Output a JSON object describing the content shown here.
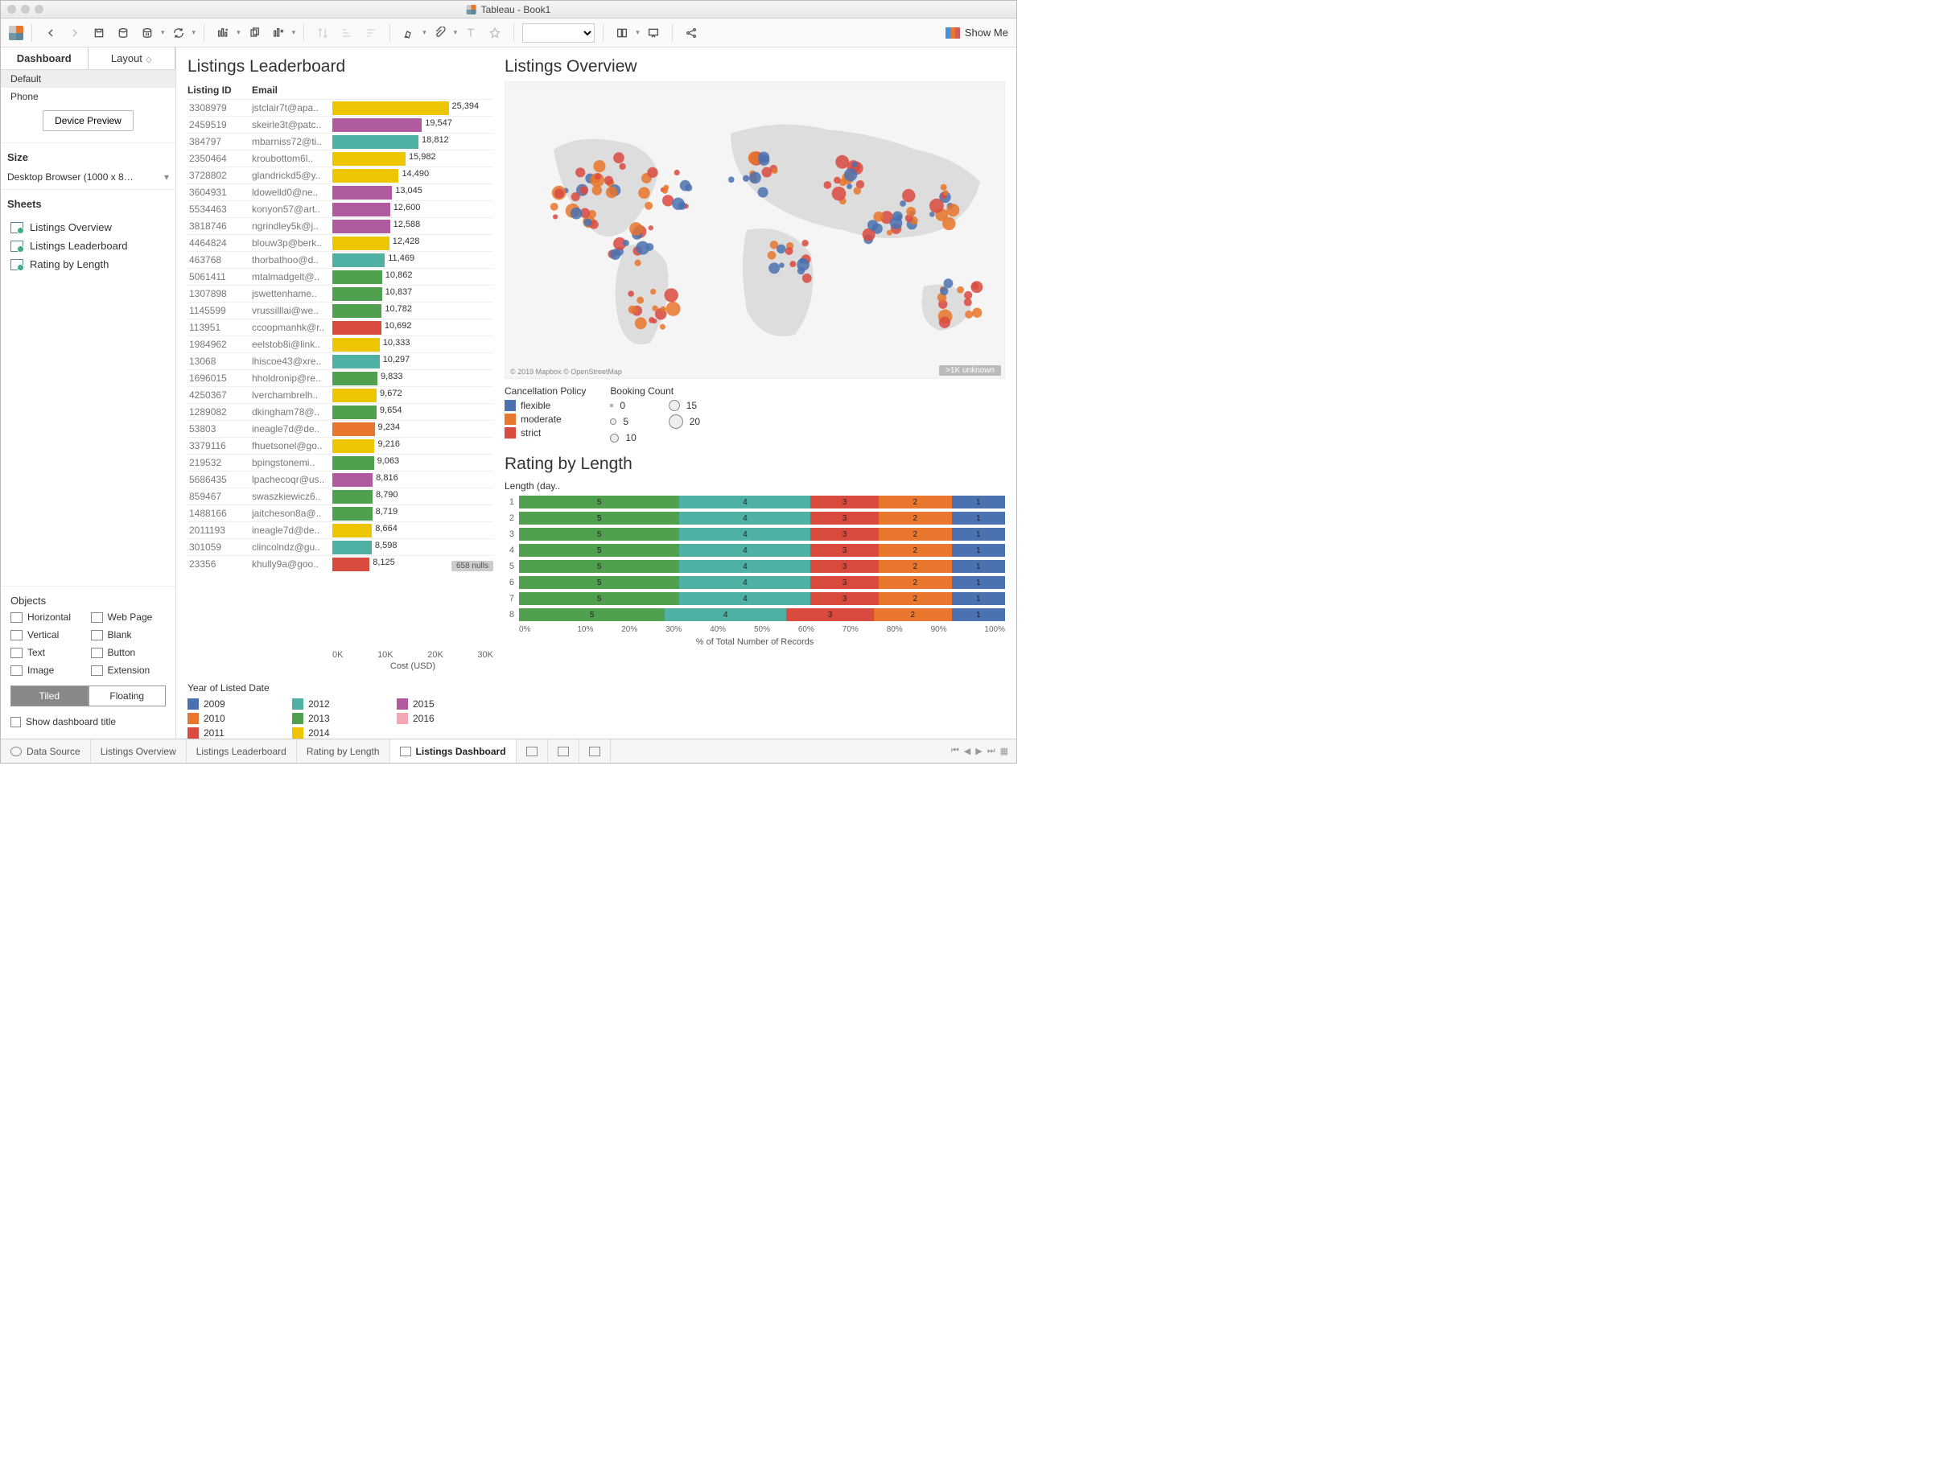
{
  "window": {
    "title": "Tableau - Book1"
  },
  "showme": "Show Me",
  "sidebar": {
    "tabs": [
      "Dashboard",
      "Layout"
    ],
    "devices": {
      "default": "Default",
      "phone": "Phone",
      "preview": "Device Preview"
    },
    "size": {
      "label": "Size",
      "value": "Desktop Browser (1000 x 8…"
    },
    "sheets": {
      "label": "Sheets",
      "items": [
        "Listings Overview",
        "Listings Leaderboard",
        "Rating by Length"
      ]
    },
    "objects": {
      "label": "Objects",
      "items": [
        "Horizontal",
        "Web Page",
        "Vertical",
        "Blank",
        "Text",
        "Button",
        "Image",
        "Extension"
      ],
      "tiled": "Tiled",
      "floating": "Floating",
      "showtitle": "Show dashboard title"
    }
  },
  "leaderboard": {
    "title": "Listings Leaderboard",
    "headers": {
      "id": "Listing ID",
      "email": "Email"
    },
    "axis": [
      "0K",
      "10K",
      "20K",
      "30K"
    ],
    "axis_label": "Cost (USD)",
    "nulls": "658 nulls",
    "max": 25394,
    "rows": [
      {
        "id": "3308979",
        "email": "jstclair7t@apa..",
        "val": 25394,
        "c": "#edc500"
      },
      {
        "id": "2459519",
        "email": "skeirle3t@patc..",
        "val": 19547,
        "c": "#b05aa0"
      },
      {
        "id": "384797",
        "email": "mbarniss72@ti..",
        "val": 18812,
        "c": "#4fb1a3"
      },
      {
        "id": "2350464",
        "email": "kroubottom6l..",
        "val": 15982,
        "c": "#edc500"
      },
      {
        "id": "3728802",
        "email": "glandrickd5@y..",
        "val": 14490,
        "c": "#edc500"
      },
      {
        "id": "3604931",
        "email": "ldowelld0@ne..",
        "val": 13045,
        "c": "#b05aa0"
      },
      {
        "id": "5534463",
        "email": "konyon57@art..",
        "val": 12600,
        "c": "#b05aa0"
      },
      {
        "id": "3818746",
        "email": "ngrindley5k@j..",
        "val": 12588,
        "c": "#b05aa0"
      },
      {
        "id": "4464824",
        "email": "blouw3p@berk..",
        "val": 12428,
        "c": "#edc500"
      },
      {
        "id": "463768",
        "email": "thorbathoo@d..",
        "val": 11469,
        "c": "#4fb1a3"
      },
      {
        "id": "5061411",
        "email": "mtalmadgelt@..",
        "val": 10862,
        "c": "#50a050"
      },
      {
        "id": "1307898",
        "email": "jswettenhame..",
        "val": 10837,
        "c": "#50a050"
      },
      {
        "id": "1145599",
        "email": "vrussilllai@we..",
        "val": 10782,
        "c": "#50a050"
      },
      {
        "id": "113951",
        "email": "ccoopmanhk@r..",
        "val": 10692,
        "c": "#d94a3f"
      },
      {
        "id": "1984962",
        "email": "eelstob8i@link..",
        "val": 10333,
        "c": "#edc500"
      },
      {
        "id": "13068",
        "email": "lhiscoe43@xre..",
        "val": 10297,
        "c": "#4fb1a3"
      },
      {
        "id": "1696015",
        "email": "hholdronip@re..",
        "val": 9833,
        "c": "#50a050"
      },
      {
        "id": "4250367",
        "email": "lverchambrelh..",
        "val": 9672,
        "c": "#edc500"
      },
      {
        "id": "1289082",
        "email": "dkingham78@..",
        "val": 9654,
        "c": "#50a050"
      },
      {
        "id": "53803",
        "email": "ineagle7d@de..",
        "val": 9234,
        "c": "#e8762c"
      },
      {
        "id": "3379116",
        "email": "fhuetsonel@go..",
        "val": 9216,
        "c": "#edc500"
      },
      {
        "id": "219532",
        "email": "bpingstonemi..",
        "val": 9063,
        "c": "#50a050"
      },
      {
        "id": "5686435",
        "email": "lpachecoqr@us..",
        "val": 8816,
        "c": "#b05aa0"
      },
      {
        "id": "859467",
        "email": "swaszkiewicz6..",
        "val": 8790,
        "c": "#50a050"
      },
      {
        "id": "1488166",
        "email": "jaitcheson8a@..",
        "val": 8719,
        "c": "#50a050"
      },
      {
        "id": "2011193",
        "email": "ineagle7d@de..",
        "val": 8664,
        "c": "#edc500"
      },
      {
        "id": "301059",
        "email": "clincolndz@gu..",
        "val": 8598,
        "c": "#4fb1a3"
      },
      {
        "id": "23356",
        "email": "khully9a@goo..",
        "val": 8125,
        "c": "#d94a3f"
      }
    ]
  },
  "year_legend": {
    "title": "Year of Listed Date",
    "items": [
      {
        "y": "2009",
        "c": "#4a72b0"
      },
      {
        "y": "2012",
        "c": "#4fb1a3"
      },
      {
        "y": "2015",
        "c": "#b05aa0"
      },
      {
        "y": "2010",
        "c": "#e8762c"
      },
      {
        "y": "2013",
        "c": "#50a050"
      },
      {
        "y": "2016",
        "c": "#f3a6b5"
      },
      {
        "y": "2011",
        "c": "#d94a3f"
      },
      {
        "y": "2014",
        "c": "#edc500"
      }
    ]
  },
  "overview": {
    "title": "Listings Overview",
    "attrib": "© 2019 Mapbox © OpenStreetMap",
    "unknown": ">1K unknown",
    "policy": {
      "title": "Cancellation Policy",
      "items": [
        {
          "l": "flexible",
          "c": "#4a72b0"
        },
        {
          "l": "moderate",
          "c": "#e8762c"
        },
        {
          "l": "strict",
          "c": "#d94a3f"
        }
      ]
    },
    "booking": {
      "title": "Booking Count",
      "items": [
        {
          "l": "0",
          "s": 4
        },
        {
          "l": "15",
          "s": 14
        },
        {
          "l": "5",
          "s": 8
        },
        {
          "l": "20",
          "s": 18
        },
        {
          "l": "10",
          "s": 11
        }
      ]
    }
  },
  "rating": {
    "title": "Rating by Length",
    "sub": "Length (day..",
    "xlabel": "% of Total Number of Records",
    "axis": [
      "0%",
      "10%",
      "20%",
      "30%",
      "40%",
      "50%",
      "60%",
      "70%",
      "80%",
      "90%",
      "100%"
    ],
    "rows": [
      1,
      2,
      3,
      4,
      5,
      6,
      7,
      8
    ],
    "segs": [
      {
        "v": "5",
        "w": 33,
        "c": "#50a050"
      },
      {
        "v": "4",
        "w": 27,
        "c": "#4fb1a3"
      },
      {
        "v": "3",
        "w": 14,
        "c": "#d94a3f"
      },
      {
        "v": "2",
        "w": 15,
        "c": "#e8762c"
      },
      {
        "v": "1",
        "w": 11,
        "c": "#4a72b0"
      }
    ],
    "alt_segs": [
      {
        "v": "5",
        "w": 30,
        "c": "#50a050"
      },
      {
        "v": "4",
        "w": 25,
        "c": "#4fb1a3"
      },
      {
        "v": "3",
        "w": 18,
        "c": "#d94a3f"
      },
      {
        "v": "2",
        "w": 16,
        "c": "#e8762c"
      },
      {
        "v": "1",
        "w": 11,
        "c": "#4a72b0"
      }
    ]
  },
  "bottom_tabs": {
    "datasource": "Data Source",
    "tabs": [
      "Listings Overview",
      "Listings Leaderboard",
      "Rating by Length",
      "Listings Dashboard"
    ]
  },
  "chart_data": {
    "leaderboard": {
      "type": "bar",
      "xlabel": "Cost (USD)",
      "xlim": [
        0,
        30000
      ],
      "color_field": "Year of Listed Date",
      "series": "see leaderboard.rows for id/email/value/color"
    },
    "overview_map": {
      "type": "map",
      "color_field": "Cancellation Policy",
      "color_values": [
        "flexible",
        "moderate",
        "strict"
      ],
      "size_field": "Booking Count",
      "size_range": [
        0,
        20
      ]
    },
    "rating_by_length": {
      "type": "stacked-bar-100pct",
      "ylabel": "Length (days)",
      "xlabel": "% of Total Number of Records",
      "categories": [
        1,
        2,
        3,
        4,
        5,
        6,
        7,
        8
      ],
      "stack_field": "Rating",
      "stack_values": [
        5,
        4,
        3,
        2,
        1
      ],
      "approx_pct_default": [
        33,
        27,
        14,
        15,
        11
      ],
      "approx_pct_row8": [
        30,
        25,
        18,
        16,
        11
      ]
    }
  }
}
